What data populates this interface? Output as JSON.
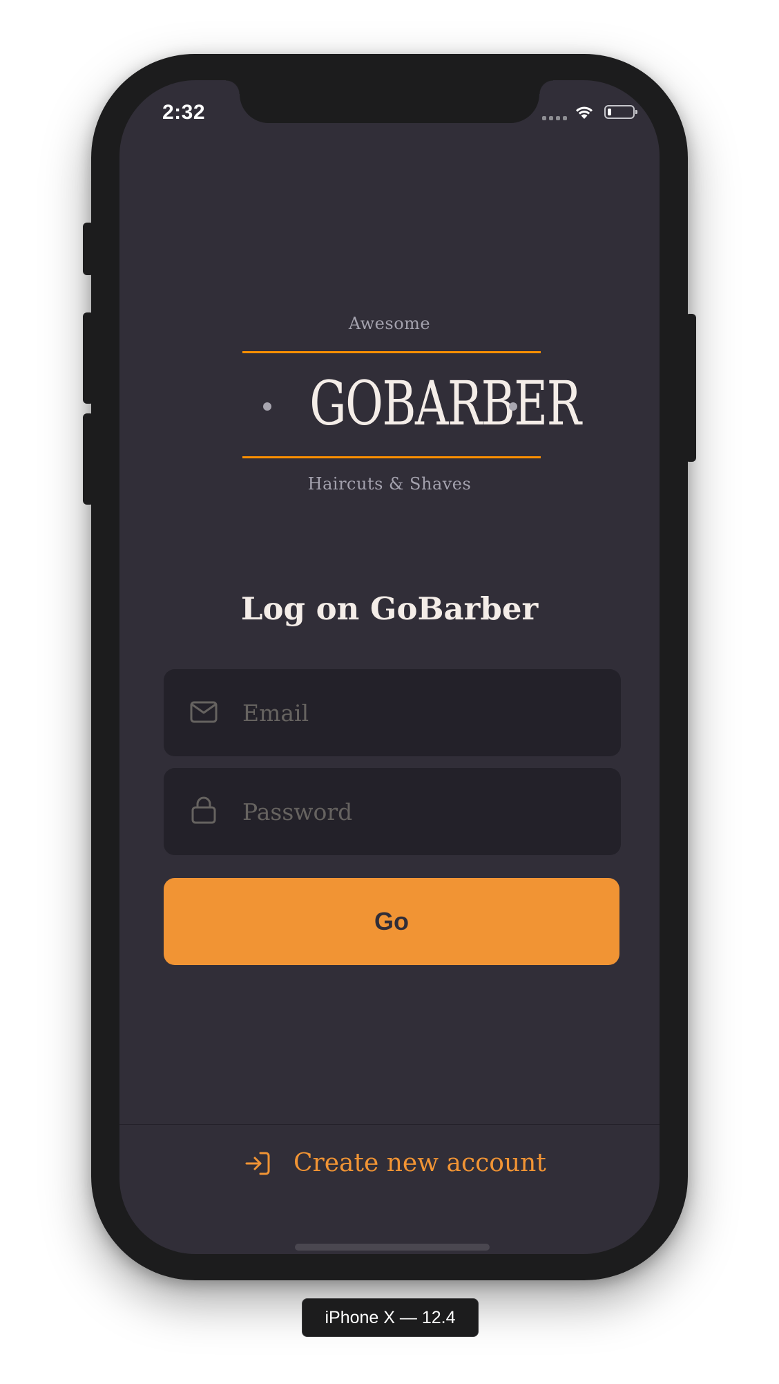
{
  "status_bar": {
    "time": "2:32",
    "signal_icon": "cellular-signal-icon",
    "wifi_icon": "wifi-icon",
    "battery_icon": "battery-icon",
    "battery_level": 0.15
  },
  "logo": {
    "tagline_top": "Awesome",
    "wordmark": "GOBARBER",
    "tagline_bottom": "Haircuts & Shaves",
    "accent_color": "#ff9000"
  },
  "login_form": {
    "title": "Log on GoBarber",
    "email": {
      "icon": "mail-icon",
      "placeholder": "Email",
      "value": ""
    },
    "password": {
      "icon": "lock-icon",
      "placeholder": "Password",
      "value": ""
    },
    "submit_label": "Go"
  },
  "footer": {
    "icon": "log-in-icon",
    "create_account_label": "Create new account"
  },
  "simulator": {
    "device_label": "iPhone X — 12.4"
  },
  "colors": {
    "background": "#312e38",
    "input_background": "#232129",
    "primary": "#f19434",
    "text": "#f4ede8",
    "placeholder": "#666360"
  }
}
